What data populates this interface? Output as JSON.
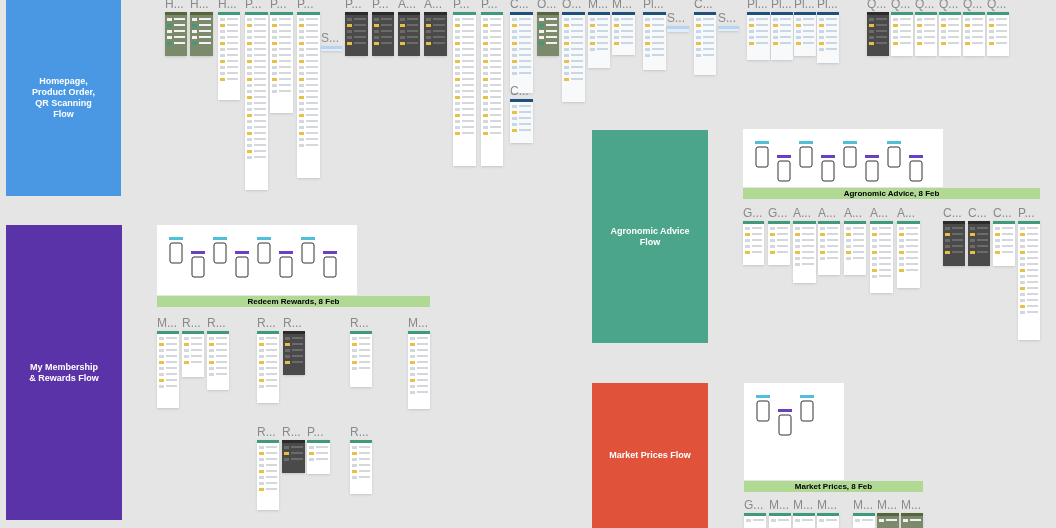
{
  "sections": [
    {
      "title": "Homepage,\nProduct Order,\nQR Scanning\nFlow",
      "color": "#4a98e4"
    },
    {
      "title": "My Membership\n& Rewards Flow",
      "color": "#5b33a8"
    },
    {
      "title": "Agronomic Advice\nFlow",
      "color": "#4aa58a"
    },
    {
      "title": "Market Prices Flow",
      "color": "#e0533a"
    }
  ],
  "boards": [
    {
      "caption": "Redeem Rewards, 8 Feb"
    },
    {
      "caption": "Agronomic Advice, 8 Feb"
    },
    {
      "caption": "Market Prices, 8 Feb"
    }
  ],
  "frames": [
    {
      "label": "H...",
      "kind": "photo"
    },
    {
      "label": "H...",
      "kind": "photo"
    },
    {
      "label": "H...",
      "kind": "light"
    },
    {
      "label": "P...",
      "kind": "light"
    },
    {
      "label": "P...",
      "kind": "light"
    },
    {
      "label": "P...",
      "kind": "light"
    },
    {
      "label": "S...",
      "kind": "strip"
    },
    {
      "label": "P...",
      "kind": "dark"
    },
    {
      "label": "P...",
      "kind": "dark"
    },
    {
      "label": "A...",
      "kind": "dark"
    },
    {
      "label": "A...",
      "kind": "dark"
    },
    {
      "label": "P...",
      "kind": "light"
    },
    {
      "label": "P...",
      "kind": "light"
    },
    {
      "label": "C...",
      "kind": "blue"
    },
    {
      "label": "C...",
      "kind": "blue"
    },
    {
      "label": "O...",
      "kind": "photo"
    },
    {
      "label": "O...",
      "kind": "blue"
    },
    {
      "label": "M...",
      "kind": "blue"
    },
    {
      "label": "M...",
      "kind": "blue"
    },
    {
      "label": "Pl...",
      "kind": "blue"
    },
    {
      "label": "S...",
      "kind": "strip"
    },
    {
      "label": "C...",
      "kind": "blue"
    },
    {
      "label": "S...",
      "kind": "strip"
    },
    {
      "label": "Pl...",
      "kind": "blue"
    },
    {
      "label": "Pl...",
      "kind": "blue"
    },
    {
      "label": "Pl...",
      "kind": "blue"
    },
    {
      "label": "Pl...",
      "kind": "blue"
    },
    {
      "label": "Q...",
      "kind": "dark"
    },
    {
      "label": "Q...",
      "kind": "light"
    },
    {
      "label": "Q...",
      "kind": "light"
    },
    {
      "label": "Q...",
      "kind": "light"
    },
    {
      "label": "Q...",
      "kind": "light"
    },
    {
      "label": "Q...",
      "kind": "light"
    },
    {
      "label": "M...",
      "kind": "light"
    },
    {
      "label": "R...",
      "kind": "light"
    },
    {
      "label": "R...",
      "kind": "light"
    },
    {
      "label": "R...",
      "kind": "light"
    },
    {
      "label": "R...",
      "kind": "dark"
    },
    {
      "label": "R...",
      "kind": "light"
    },
    {
      "label": "M...",
      "kind": "light"
    },
    {
      "label": "R...",
      "kind": "light"
    },
    {
      "label": "R...",
      "kind": "dark"
    },
    {
      "label": "P...",
      "kind": "light"
    },
    {
      "label": "R...",
      "kind": "light"
    },
    {
      "label": "G...",
      "kind": "light"
    },
    {
      "label": "G...",
      "kind": "light"
    },
    {
      "label": "A...",
      "kind": "light"
    },
    {
      "label": "A...",
      "kind": "light"
    },
    {
      "label": "A...",
      "kind": "light"
    },
    {
      "label": "A...",
      "kind": "light"
    },
    {
      "label": "A...",
      "kind": "light"
    },
    {
      "label": "C...",
      "kind": "dark"
    },
    {
      "label": "C...",
      "kind": "dark"
    },
    {
      "label": "C...",
      "kind": "light"
    },
    {
      "label": "P...",
      "kind": "light"
    },
    {
      "label": "G...",
      "kind": "light"
    },
    {
      "label": "M...",
      "kind": "light"
    },
    {
      "label": "M...",
      "kind": "light"
    },
    {
      "label": "M...",
      "kind": "light"
    },
    {
      "label": "M...",
      "kind": "light"
    },
    {
      "label": "M...",
      "kind": "photo"
    },
    {
      "label": "M...",
      "kind": "photo"
    }
  ]
}
